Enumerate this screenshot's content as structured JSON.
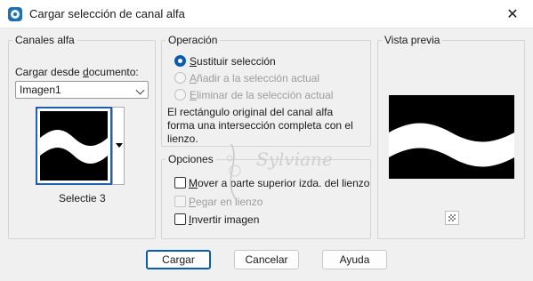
{
  "window": {
    "title": "Cargar selección de canal alfa",
    "close_glyph": "✕",
    "icon": "target-icon"
  },
  "channels": {
    "legend": "Canales alfa",
    "load_label_prefix": "Cargar desde ",
    "load_label_underlined": "d",
    "load_label_suffix": "ocumento:",
    "document_value": "Imagen1",
    "selection_name": "Selectie 3"
  },
  "operation": {
    "legend": "Operación",
    "options": [
      {
        "u": "S",
        "rest": "ustituir selección",
        "checked": true,
        "disabled": false
      },
      {
        "u": "A",
        "rest": "ñadir a la selección actual",
        "checked": false,
        "disabled": true
      },
      {
        "u": "E",
        "rest": "liminar de la selección actual",
        "checked": false,
        "disabled": true
      }
    ],
    "description": "El rectángulo original del canal alfa forma una intersección completa con el lienzo."
  },
  "options": {
    "legend": "Opciones",
    "checks": [
      {
        "u": "M",
        "rest": "over a parte superior izda. del lienzo",
        "checked": false,
        "disabled": false
      },
      {
        "u": "P",
        "rest": "egar en lienzo",
        "checked": false,
        "disabled": true
      },
      {
        "u": "I",
        "rest": "nvertir imagen",
        "checked": false,
        "disabled": false
      }
    ]
  },
  "preview": {
    "legend": "Vista previa"
  },
  "watermark": {
    "text": "Sylviane"
  },
  "buttons": {
    "load": "Cargar",
    "cancel": "Cancelar",
    "help": "Ayuda"
  },
  "colors": {
    "accent": "#0b5cad",
    "selection_border": "#1f5fae",
    "preview_bg": "#000000",
    "wave": "#ffffff"
  }
}
